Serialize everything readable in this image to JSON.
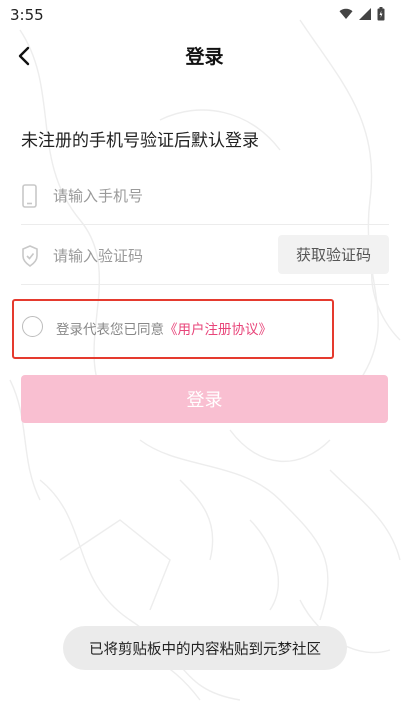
{
  "status_bar": {
    "time": "3:55",
    "icons": [
      "wifi-icon",
      "signal-icon",
      "battery-icon"
    ]
  },
  "header": {
    "title": "登录",
    "back_icon": "chevron-left-icon"
  },
  "subtitle": "未注册的手机号验证后默认登录",
  "phone_field": {
    "placeholder": "请输入手机号",
    "value": "",
    "icon": "phone-icon"
  },
  "code_field": {
    "placeholder": "请输入验证码",
    "value": "",
    "icon": "shield-icon",
    "button_label": "获取验证码"
  },
  "agreement": {
    "text": "登录代表您已同意",
    "link": "《用户注册协议》",
    "checked": false
  },
  "login_button": {
    "label": "登录"
  },
  "toast": {
    "text": "已将剪贴板中的内容粘贴到元梦社区"
  },
  "colors": {
    "accent_pink": "#e8457a",
    "login_button_bg": "#f9bfd1",
    "highlight_border": "#e53a2e"
  }
}
